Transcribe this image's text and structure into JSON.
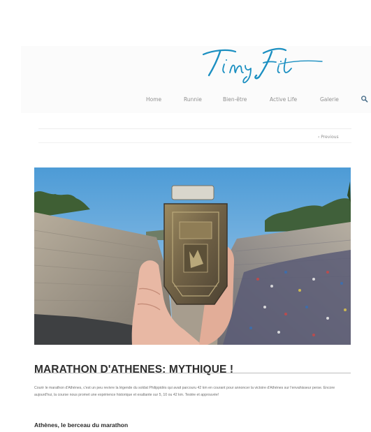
{
  "brand": {
    "logo_text": "Tiny Fit"
  },
  "nav": {
    "items": [
      "Home",
      "Runnie",
      "Bien-être",
      "Active Life",
      "Galerie"
    ],
    "search_icon": "search-icon"
  },
  "pagination": {
    "prev": "‹ Previous"
  },
  "post": {
    "title": "MARATHON D'ATHENES: MYTHIQUE !",
    "excerpt": "Courir le marathon d'Athènes, c'est un peu revivre la légende du soldat Philippidès qui avait parcouru 42 km en courant pour annoncer la victoire d'Athènes sur l'envahisseur perse. Encore aujourd'hui, la course nous promet une expérience historique et exaltante sur 5, 10 ou 42 km. Testée et approuvée!",
    "subheading": "Athènes, le berceau du marathon"
  },
  "colors": {
    "accent": "#1b8fc1",
    "nav_text": "#8f8f8f",
    "title_text": "#2e2e2e"
  }
}
